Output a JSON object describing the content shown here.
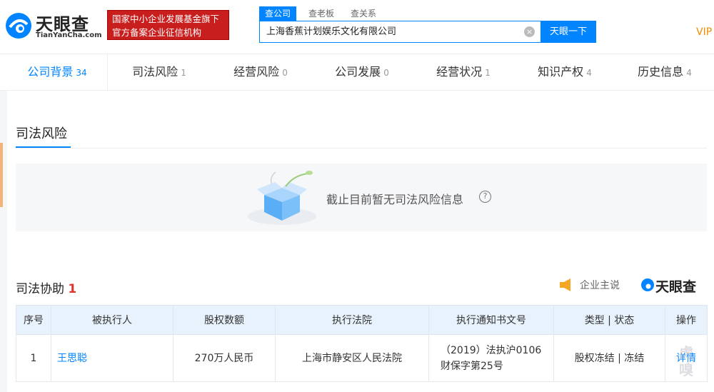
{
  "brand": {
    "logo_text": "天眼查",
    "logo_sub": "TianYanCha.com",
    "badge_line1": "国家中小企业发展基金旗下",
    "badge_line2": "官方备案企业征信机构",
    "vip": "VIP",
    "mini_logo_text": "天眼查"
  },
  "search": {
    "tabs": [
      "查公司",
      "查老板",
      "查关系"
    ],
    "active_tab": "查公司",
    "value": "上海香蕉计划娱乐文化有限公司",
    "button": "天眼一下"
  },
  "nav_tabs": [
    {
      "label": "公司背景",
      "count": "34"
    },
    {
      "label": "司法风险",
      "count": "1"
    },
    {
      "label": "经营风险",
      "count": "0"
    },
    {
      "label": "公司发展",
      "count": "0"
    },
    {
      "label": "经营状况",
      "count": "1"
    },
    {
      "label": "知识产权",
      "count": "4"
    },
    {
      "label": "历史信息",
      "count": "4"
    }
  ],
  "section": {
    "title": "司法风险",
    "empty_text": "截止目前暂无司法风险信息",
    "help": "?"
  },
  "assist": {
    "title": "司法协助",
    "count": "1",
    "owner_label": "企业主说"
  },
  "table": {
    "headers": [
      "序号",
      "被执行人",
      "股权数额",
      "执行法院",
      "执行通知书文号",
      "类型 | 状态",
      "操作"
    ],
    "rows": [
      {
        "index": "1",
        "name": "王思聪",
        "amount": "270万人民币",
        "court": "上海市静安区人民法院",
        "doc_line1": "（2019）法执沪0106",
        "doc_line2": "财保字第25号",
        "type_status": "股权冻结 | 冻结",
        "action": "详情"
      }
    ]
  },
  "colors": {
    "accent": "#0084ff",
    "badge_red": "#c81e1e",
    "count_red": "#e0332c",
    "vip_orange": "#f08c00"
  }
}
